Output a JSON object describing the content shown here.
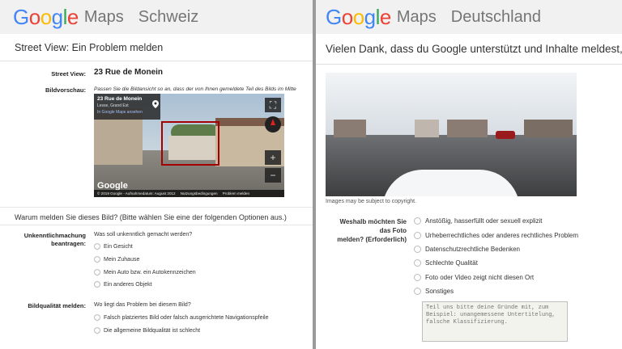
{
  "left": {
    "logo": "Google",
    "product": "Maps",
    "country": "Schweiz",
    "title": "Street View: Ein Problem melden",
    "street_view_label": "Street View:",
    "street_view_value": "23 Rue de Monein",
    "preview_label": "Bildvorschau:",
    "preview_hint": "Passen Sie die Bildansicht so an, dass der von Ihnen gemeldete Teil des Bilds im Mitte",
    "preview": {
      "card_title": "23 Rue de Monein",
      "card_sub": "Lesse, Grand Est",
      "card_link": "In Google Maps ansehen",
      "google_mark": "Google",
      "footer_1": "© 2019 Google - Aufnahmedatum: August 2012",
      "footer_2": "Nutzungsbedingungen",
      "footer_3": "Problem melden",
      "zoom_in": "+",
      "zoom_out": "−"
    },
    "question": "Warum melden Sie dieses Bild? (Bitte wählen Sie eine der folgenden Optionen aus.)",
    "blur": {
      "label_1": "Unkenntlichmachung",
      "label_2": "beantragen:",
      "question": "Was soll unkenntlich gemacht werden?",
      "options": [
        "Ein Gesicht",
        "Mein Zuhause",
        "Mein Auto bzw. ein Autokennzeichen",
        "Ein anderes Objekt"
      ]
    },
    "quality": {
      "label": "Bildqualität melden:",
      "question": "Wo liegt das Problem bei diesem Bild?",
      "options": [
        "Falsch platziertes Bild oder falsch ausgerichtete Navigationspfeile",
        "Die allgemeine Bildqualität ist schlecht"
      ]
    }
  },
  "right": {
    "logo": "Google",
    "product": "Maps",
    "country": "Deutschland",
    "title": "Vielen Dank, dass du Google unterstützt und Inhalte meldest, di",
    "copyright": "Images may be subject to copyright.",
    "reason_label_1": "Weshalb möchten Sie",
    "reason_label_2": "das Foto",
    "reason_label_3": "melden? (Erforderlich)",
    "options": [
      "Anstößig, hasserfüllt oder sexuell explizit",
      "Urheberrechtliches oder anderes rechtliches Problem",
      "Datenschutzrechtliche Bedenken",
      "Schlechte Qualität",
      "Foto oder Video zeigt nicht diesen Ort",
      "Sonstiges"
    ],
    "textarea_placeholder": "Teil uns bitte deine Gründe mit, zum Beispiel: unangemessene Untertitelung, falsche Klassifizierung."
  },
  "colors": {
    "google_blue": "#4285F4",
    "google_red": "#EA4335",
    "google_yellow": "#FBBC05",
    "google_green": "#34A853",
    "highlight_box": "#a40000"
  }
}
